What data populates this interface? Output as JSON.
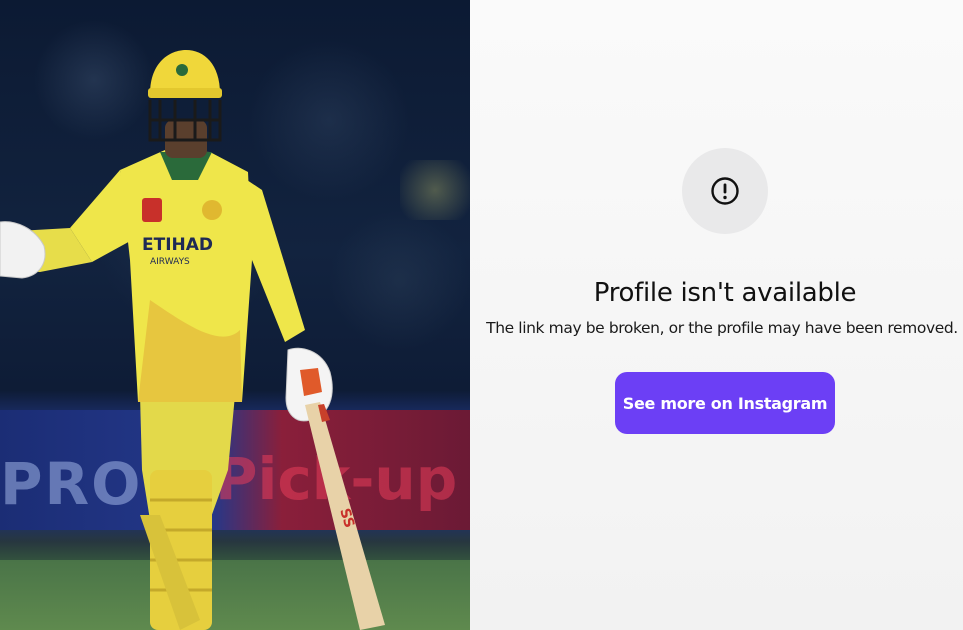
{
  "photo": {
    "jersey_sponsor": "ETIHAD",
    "jersey_sub": "AIRWAYS",
    "hoarding_left": "PROD",
    "hoarding_right": "Pick-up"
  },
  "panel": {
    "icon": "exclamation-circle-icon",
    "title": "Profile isn't available",
    "subtitle": "The link may be broken, or the profile may have been removed.",
    "cta_label": "See more on Instagram",
    "colors": {
      "cta_background": "#6c3ff5",
      "icon_circle": "#e9e9ea",
      "text": "#111111"
    }
  }
}
